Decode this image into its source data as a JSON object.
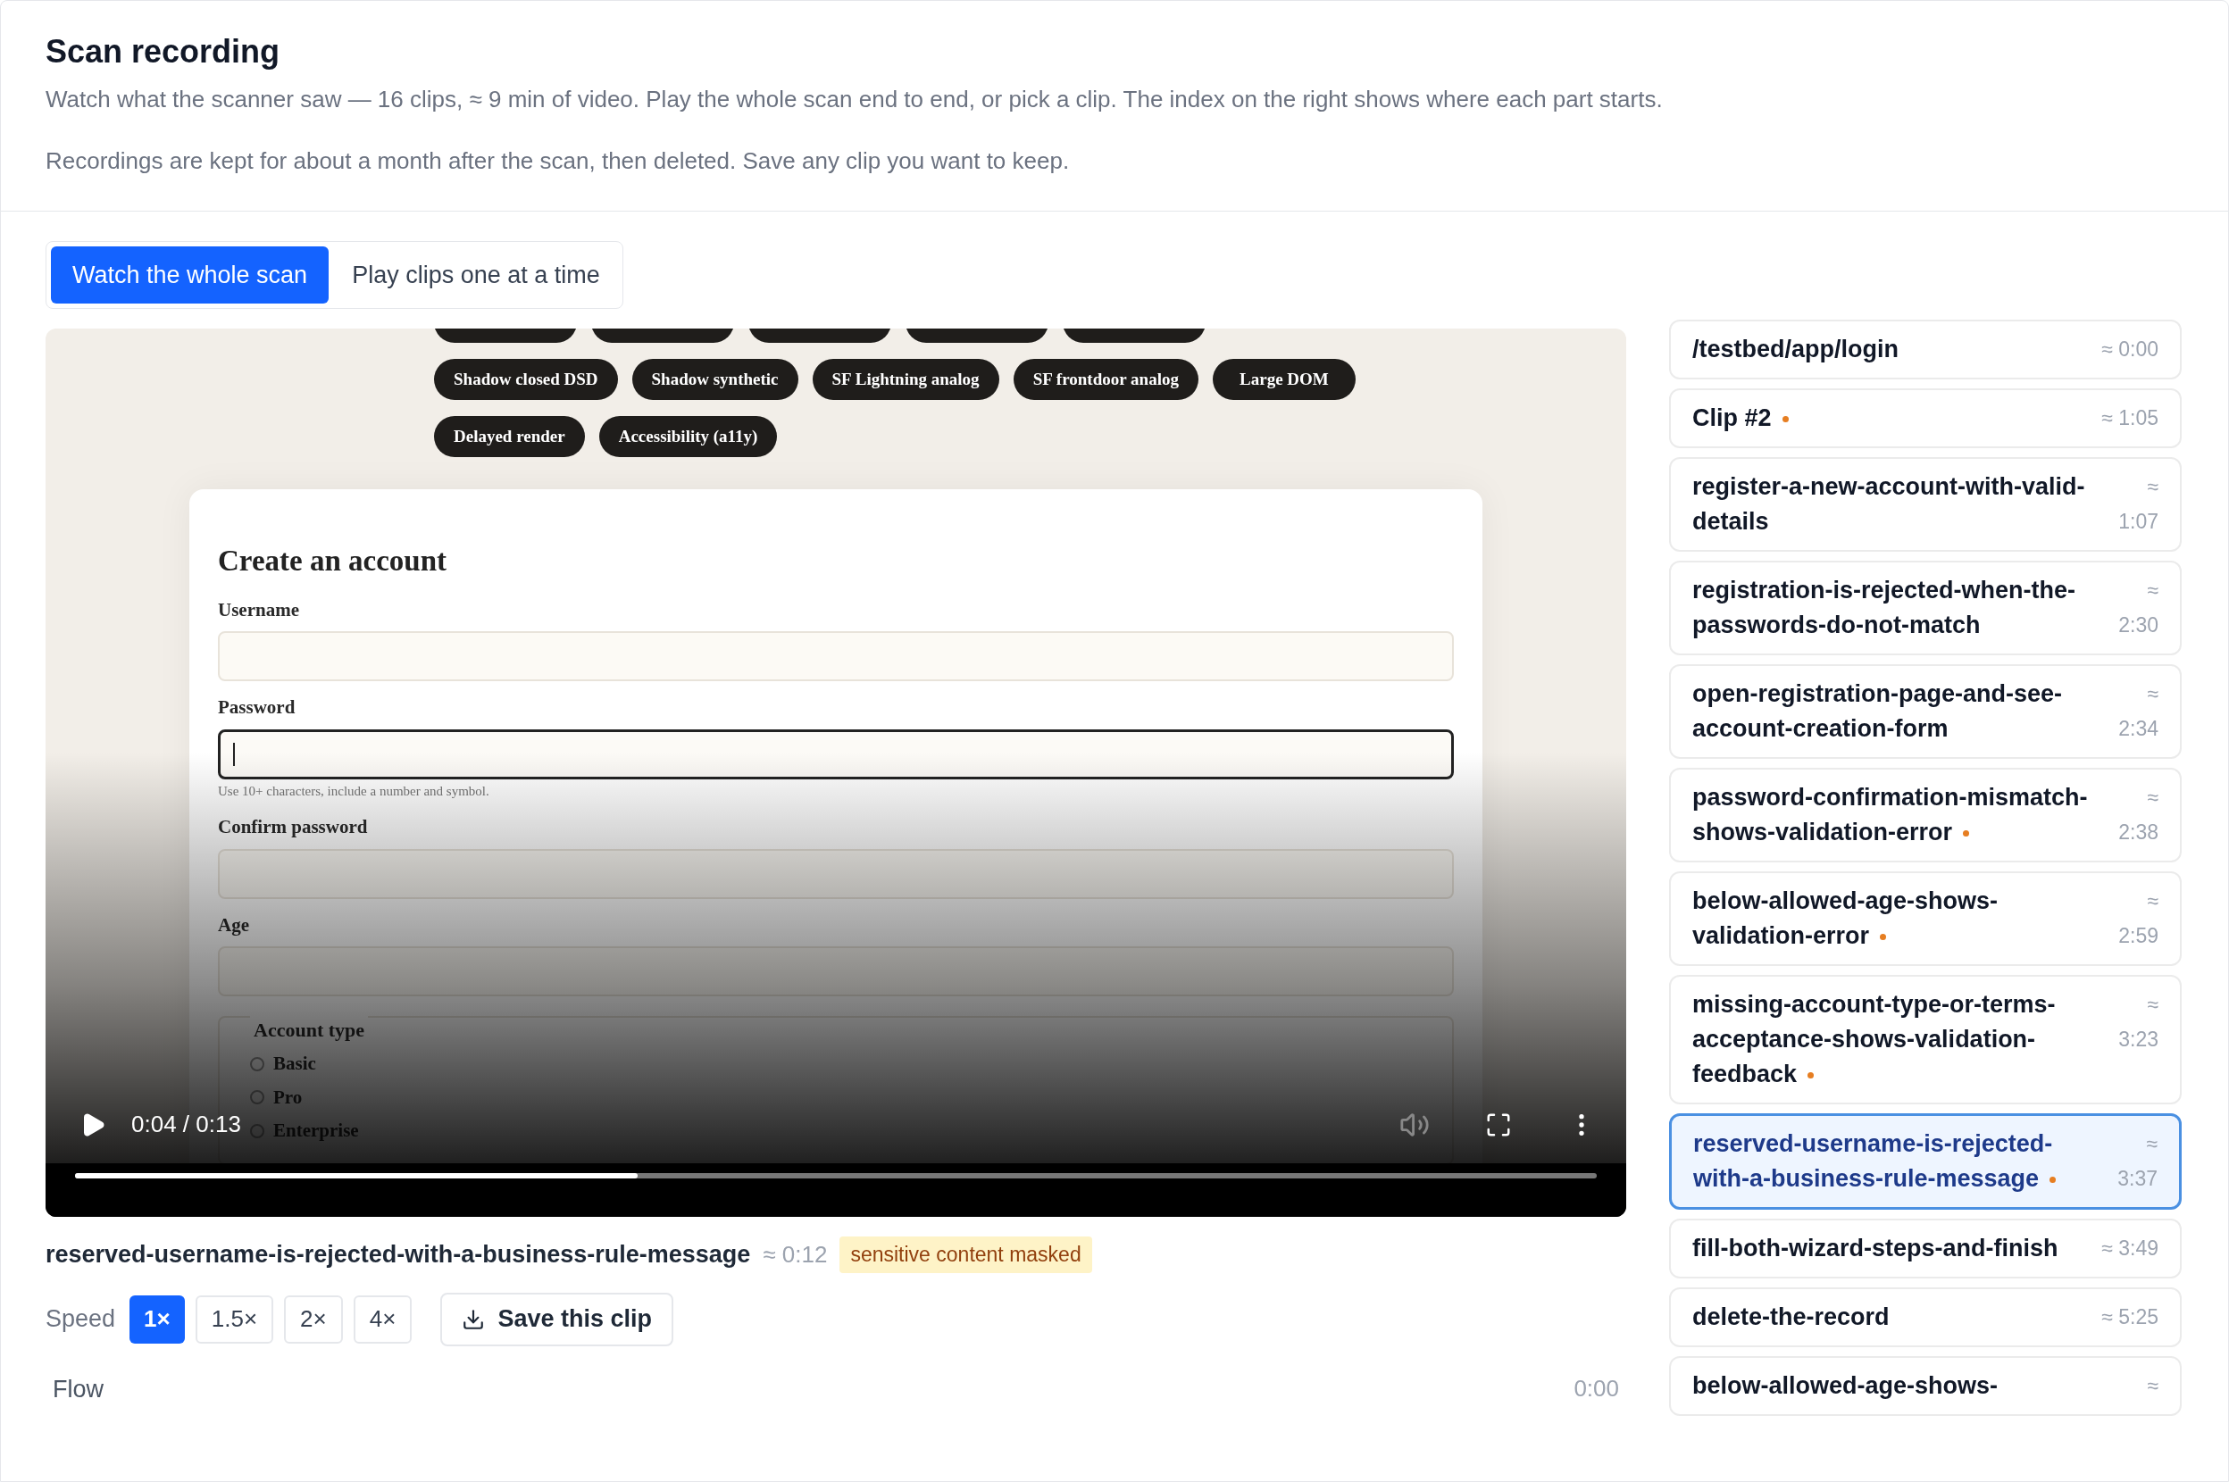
{
  "header": {
    "title": "Scan recording",
    "description": "Watch what the scanner saw — 16 clips, ≈ 9 min of video. Play the whole scan end to end, or pick a clip. The index on the right shows where each part starts.",
    "note": "Recordings are kept for about a month after the scan, then deleted. Save any clip you want to keep."
  },
  "modes": [
    {
      "label": "Watch the whole scan",
      "selected": true
    },
    {
      "label": "Play clips one at a time",
      "selected": false
    }
  ],
  "video": {
    "frame": {
      "tag_rows": [
        [
          "",
          "",
          "",
          "",
          ""
        ],
        [
          "Shadow closed DSD",
          "Shadow synthetic",
          "SF Lightning analog",
          "SF frontdoor analog",
          "Large DOM"
        ],
        [
          "Delayed render",
          "Accessibility (a11y)"
        ]
      ],
      "form_title": "Create an account",
      "fields": [
        {
          "label": "Username",
          "focused": false
        },
        {
          "label": "Password",
          "focused": true,
          "hint": "Use 10+ characters, include a number and symbol."
        },
        {
          "label": "Confirm password",
          "focused": false
        },
        {
          "label": "Age",
          "focused": false
        }
      ],
      "fieldset": {
        "legend": "Account type",
        "options": [
          {
            "label": "Basic",
            "selected": false
          },
          {
            "label": "Pro",
            "selected": false
          },
          {
            "label": "Enterprise",
            "selected": false
          }
        ]
      }
    },
    "time": "0:04 / 0:13",
    "progress": {
      "level": 0.37
    }
  },
  "clip": {
    "title": "reserved-username-is-rejected-with-a-business-rule-message",
    "duration": "≈ 0:12",
    "badge": "sensitive content masked"
  },
  "speed": {
    "label": "Speed",
    "options": [
      {
        "label": "1×",
        "selected": true
      },
      {
        "label": "1.5×",
        "selected": false
      },
      {
        "label": "2×",
        "selected": false
      },
      {
        "label": "4×",
        "selected": false
      }
    ],
    "save": "Save this clip"
  },
  "flow": {
    "label": "Flow",
    "time": "0:00"
  },
  "index": [
    {
      "label": "/testbed/app/login",
      "time": "≈ 0:00",
      "flagged": false,
      "selected": false
    },
    {
      "label": "Clip #2",
      "time": "≈ 1:05",
      "flagged": true,
      "selected": false
    },
    {
      "label": "register-a-new-account-with-valid-details",
      "time": "≈ 1:07",
      "flagged": false,
      "selected": false
    },
    {
      "label": "registration-is-rejected-when-the-passwords-do-not-match",
      "time": "≈ 2:30",
      "flagged": false,
      "selected": false
    },
    {
      "label": "open-registration-page-and-see-account-creation-form",
      "time": "≈ 2:34",
      "flagged": false,
      "selected": false
    },
    {
      "label": "password-confirmation-mismatch-shows-validation-error",
      "time": "≈ 2:38",
      "flagged": true,
      "selected": false
    },
    {
      "label": "below-allowed-age-shows-validation-error",
      "time": "≈ 2:59",
      "flagged": true,
      "selected": false
    },
    {
      "label": "missing-account-type-or-terms-acceptance-shows-validation-feedback",
      "time": "≈ 3:23",
      "flagged": true,
      "selected": false
    },
    {
      "label": "reserved-username-is-rejected-with-a-business-rule-message",
      "time": "≈ 3:37",
      "flagged": true,
      "selected": true
    },
    {
      "label": "fill-both-wizard-steps-and-finish",
      "time": "≈ 3:49",
      "flagged": false,
      "selected": false
    },
    {
      "label": "delete-the-record",
      "time": "≈ 5:25",
      "flagged": false,
      "selected": false
    },
    {
      "label": "below-allowed-age-shows-",
      "time": "≈",
      "flagged": false,
      "selected": false
    }
  ]
}
